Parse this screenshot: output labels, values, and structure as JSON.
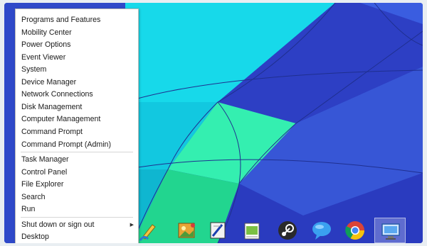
{
  "start_menu": {
    "groups": [
      [
        {
          "label": "Programs and Features"
        },
        {
          "label": "Mobility Center"
        },
        {
          "label": "Power Options"
        },
        {
          "label": "Event Viewer"
        },
        {
          "label": "System"
        },
        {
          "label": "Device Manager"
        },
        {
          "label": "Network Connections"
        },
        {
          "label": "Disk Management"
        },
        {
          "label": "Computer Management"
        },
        {
          "label": "Command Prompt"
        },
        {
          "label": "Command Prompt (Admin)"
        }
      ],
      [
        {
          "label": "Task Manager"
        },
        {
          "label": "Control Panel"
        },
        {
          "label": "File Explorer"
        },
        {
          "label": "Search"
        },
        {
          "label": "Run"
        }
      ],
      [
        {
          "label": "Shut down or sign out",
          "has_submenu": true,
          "submenu_glyph": "▶"
        },
        {
          "label": "Desktop"
        }
      ]
    ]
  },
  "taskbar": {
    "icons": [
      {
        "name": "paint-icon"
      },
      {
        "name": "photo-viewer-icon"
      },
      {
        "name": "snipping-tool-icon"
      },
      {
        "name": "notepad-icon"
      },
      {
        "name": "steam-icon"
      },
      {
        "name": "chat-icon"
      },
      {
        "name": "chrome-icon"
      },
      {
        "name": "remote-desktop-icon"
      }
    ]
  },
  "colors": {
    "wallpaper_cyan": "#17d9ea",
    "wallpaper_green": "#34efb0",
    "wallpaper_blue": "#2f48cc",
    "menu_bg": "#ffffff"
  }
}
